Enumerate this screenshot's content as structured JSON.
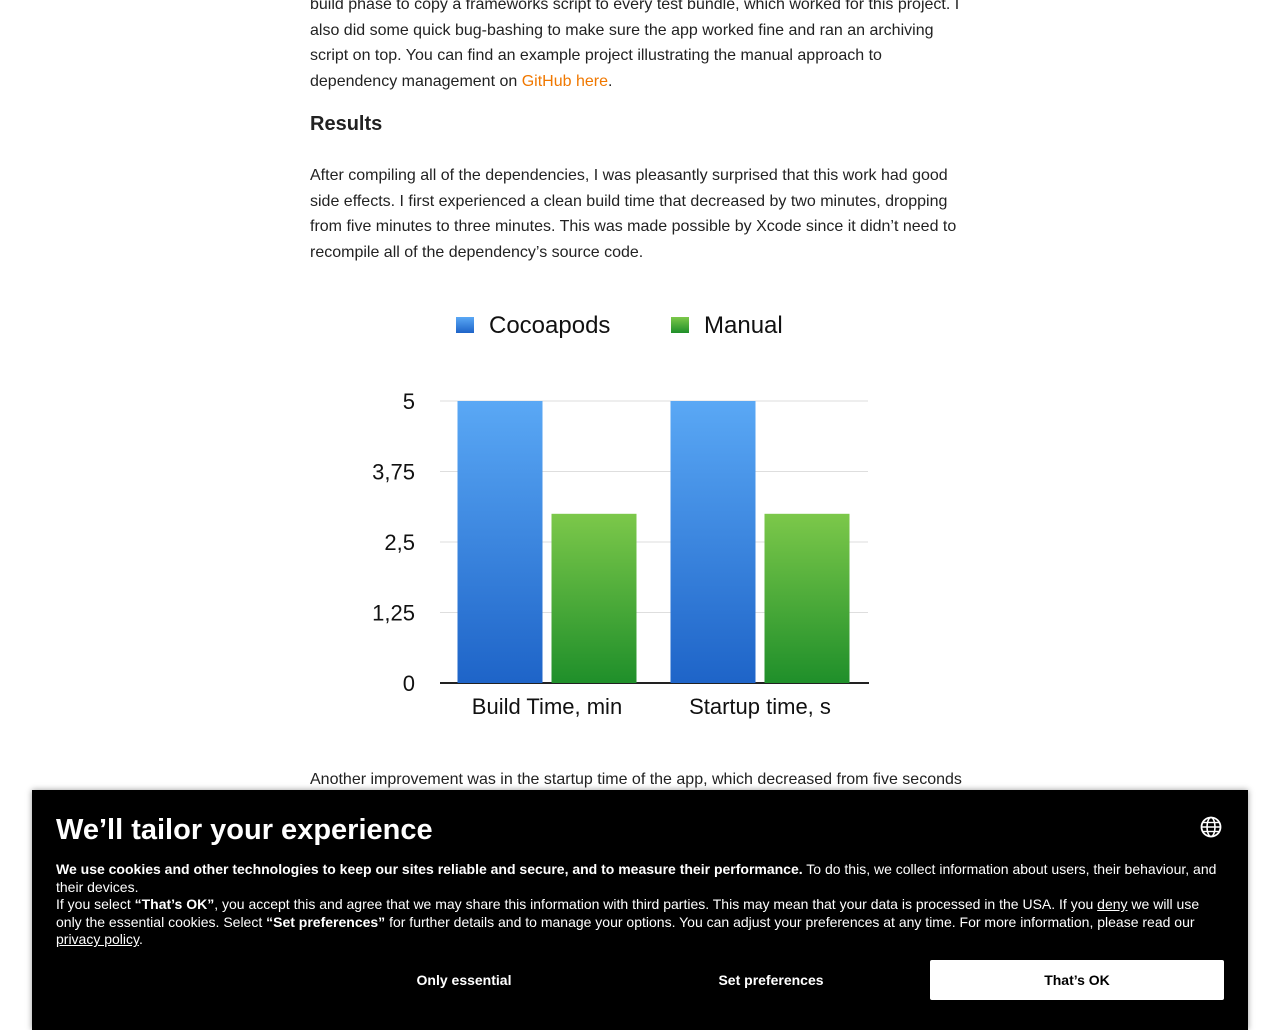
{
  "article": {
    "p1": {
      "line1": "build phase to copy a frameworks script to every test bundle, which worked for this project. I",
      "line2": "also did some quick bug-bashing to make sure the app worked fine and ran an archiving",
      "line3": "script on top. You can find an example project illustrating the manual approach to",
      "line4_pre": "dependency management on ",
      "link": "GitHub here",
      "line4_post": "."
    },
    "results_heading": "Results",
    "p2": {
      "line1": "After compiling all of the dependencies, I was pleasantly surprised that this work had good",
      "line2": "side effects. I first experienced a clean build time that decreased by two minutes, dropping",
      "line3": "from five minutes to three minutes. This was made possible by Xcode since it didn’t need to",
      "line4": "recompile all of the dependency’s source code."
    },
    "p3": "Another improvement was in the startup time of the app, which decreased from five seconds"
  },
  "chart_data": {
    "type": "bar",
    "categories": [
      "Build Time, min",
      "Startup time, s"
    ],
    "series": [
      {
        "name": "Cocoapods",
        "values": [
          5,
          5
        ],
        "color": "#2f86e0"
      },
      {
        "name": "Manual",
        "values": [
          3,
          3
        ],
        "color": "#4caf3d"
      }
    ],
    "yticks": [
      "0",
      "1,25",
      "2,5",
      "3,75",
      "5"
    ],
    "ylim": [
      0,
      5
    ],
    "legend_position": "top",
    "grid": true,
    "title": "",
    "xlabel": "",
    "ylabel": ""
  },
  "cookie": {
    "title": "We’ll tailor your experience",
    "globe_icon": "globe-icon",
    "bold_intro": "We use cookies and other technologies to keep our sites reliable and secure, and to measure their performance.",
    "intro_rest": " To do this, we collect information about users, their behaviour, and their devices.",
    "line2_a": "If you select ",
    "thats_ok_quote": "“That’s OK”",
    "line2_b": ", you accept this and agree that we may share this information with third parties. This may mean that your data is processed in the USA. If you ",
    "deny_link": "deny",
    "line2_c": " we will use only the essential cookies. Select ",
    "set_prefs_quote": "“Set preferences”",
    "line2_d": " for further details and to manage your options. You can adjust your preferences at any time. For more information, please read our ",
    "privacy_link": "privacy policy",
    "line2_e": ".",
    "btn_essential": "Only essential",
    "btn_prefs": "Set preferences",
    "btn_ok": "That’s OK"
  }
}
